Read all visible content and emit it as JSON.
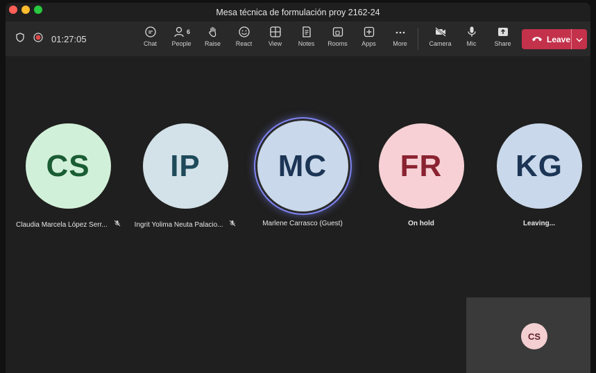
{
  "window": {
    "title": "Mesa técnica de formulación proy 2162-24"
  },
  "call": {
    "timer": "01:27:05"
  },
  "toolbar": {
    "tools": [
      {
        "label": "Chat",
        "icon": "chat-icon"
      },
      {
        "label": "People",
        "icon": "people-icon",
        "badge": "6"
      },
      {
        "label": "Raise",
        "icon": "raise-hand-icon"
      },
      {
        "label": "React",
        "icon": "react-icon"
      },
      {
        "label": "View",
        "icon": "view-icon"
      },
      {
        "label": "Notes",
        "icon": "notes-icon"
      },
      {
        "label": "Rooms",
        "icon": "rooms-icon"
      },
      {
        "label": "Apps",
        "icon": "apps-icon"
      },
      {
        "label": "More",
        "icon": "more-icon"
      }
    ],
    "devices": [
      {
        "label": "Camera",
        "icon": "camera-off-icon"
      },
      {
        "label": "Mic",
        "icon": "mic-icon"
      },
      {
        "label": "Share",
        "icon": "share-icon"
      }
    ],
    "leave_label": "Leave"
  },
  "participants": [
    {
      "initials": "CS",
      "name": "Claudia Marcela López Serr...",
      "muted": true,
      "bg": "#d1f0d9",
      "fg": "#1a5c33"
    },
    {
      "initials": "IP",
      "name": "Ingrit Yolima Neuta Palacio...",
      "muted": true,
      "bg": "#d3e1e8",
      "fg": "#1e4a5a"
    },
    {
      "initials": "MC",
      "name": "Marlene Carrasco (Guest)",
      "muted": false,
      "bg": "#c9d8ea",
      "fg": "#1c3555",
      "speaking": true
    },
    {
      "initials": "FR",
      "name": "On hold",
      "muted": false,
      "bg": "#f6d0d4",
      "fg": "#8a2331"
    },
    {
      "initials": "KG",
      "name": "Leaving...",
      "muted": false,
      "bg": "#c9d8ea",
      "fg": "#1c3555"
    }
  ],
  "self_view": {
    "initials": "CS"
  },
  "colors": {
    "leave": "#c4314b",
    "speaking_ring": "#7f85f5"
  }
}
